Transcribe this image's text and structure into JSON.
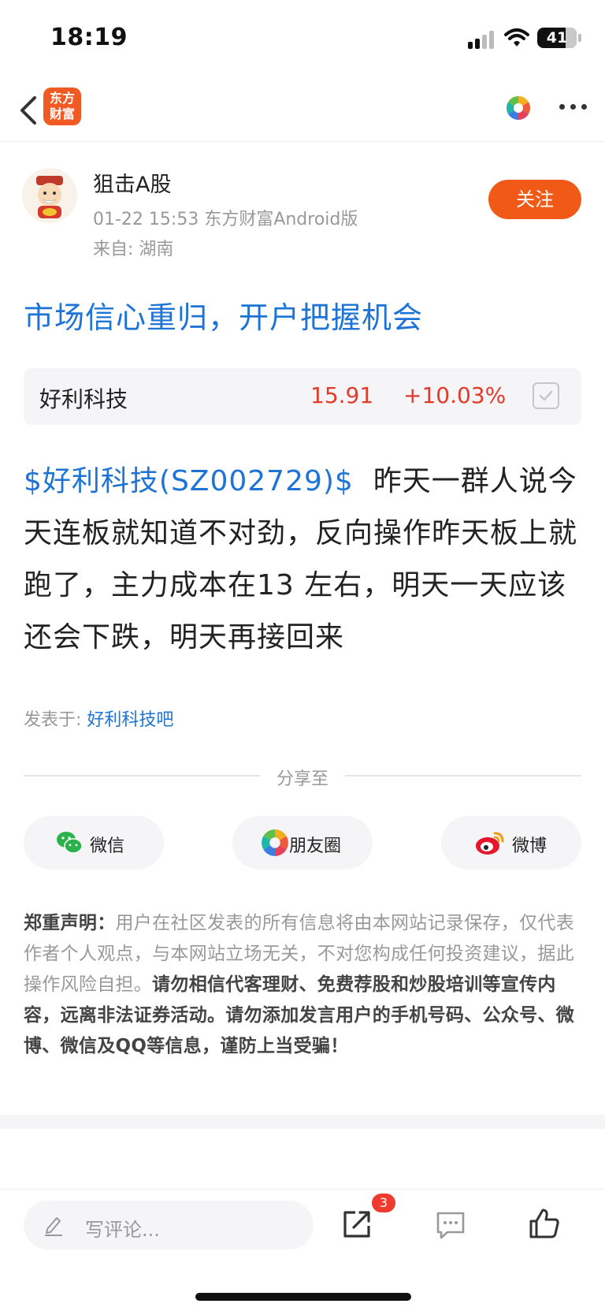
{
  "status_bar": {
    "time": "18:19",
    "battery": "41"
  },
  "nav": {
    "logo_line1": "东方",
    "logo_line2": "财富"
  },
  "author": {
    "name": "狙击A股",
    "meta": "01-22 15:53 东方财富Android版",
    "from": "来自: 湖南",
    "follow_label": "关注"
  },
  "post": {
    "title": "市场信心重归，开户把握机会",
    "stock": {
      "name": "好利科技",
      "price": "15.91",
      "change": "+10.03%"
    },
    "tag": "$好利科技(SZ002729)$",
    "body": "  昨天一群人说今天连板就知道不对劲，反向操作昨天板上就跑了，主力成本在13 左右，明天一天应该还会下跌，明天再接回来",
    "posted_in_label": "发表于: ",
    "posted_in_link": "好利科技吧"
  },
  "share": {
    "label": "分享至",
    "wechat": "微信",
    "moments": "朋友圈",
    "weibo": "微博"
  },
  "disclaimer": {
    "head": "郑重声明：",
    "normal": "用户在社区发表的所有信息将由本网站记录保存，仅代表作者个人观点，与本网站立场无关，不对您构成任何投资建议，据此操作风险自担。",
    "bold": "请勿相信代客理财、免费荐股和炒股培训等宣传内容，远离非法证券活动。请勿添加发言用户的手机号码、公众号、微博、微信及QQ等信息，谨防上当受骗！"
  },
  "bottom_bar": {
    "comment_placeholder": "写评论...",
    "share_badge": "3"
  },
  "colors": {
    "brand_orange": "#f15a16",
    "link_blue": "#1d74d6",
    "rise_red": "#e23b2a"
  }
}
